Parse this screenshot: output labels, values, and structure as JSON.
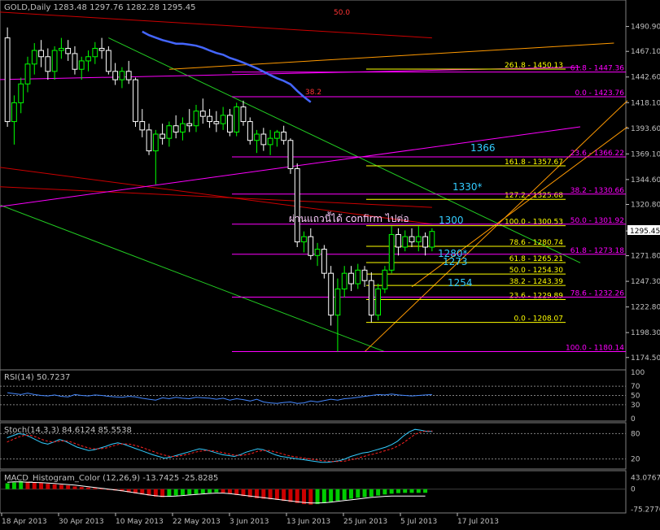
{
  "header": {
    "main": "GOLD,Daily  1283.48 1297.76 1282.28 1295.45",
    "rsi": "RSI(14) 50.7237",
    "stoch": "Stoch(14,3,3) 84.6124 85.5538",
    "macd": "MACD_Histogram_Color (12,26,9) -13.7425 -25.8285"
  },
  "colors": {
    "background": "#000000",
    "axis": "#c0c0c0",
    "candle_up": "#00ff00",
    "fib_lines": "#ffff00",
    "fib_ext": "#ff00ff",
    "trend_green": "#22cc22",
    "trend_red": "#cc0000",
    "trend_orange": "#ff9900",
    "ma_blue": "#4466ff",
    "annot_cyan": "#33ccff",
    "bands_mag": "#cc00cc"
  },
  "price_label": "1295.45",
  "annotation_text": "ผ่านแถวนี้ได้ confirm ไปต่อ",
  "targets": [
    "1366",
    "1330*",
    "1300",
    "1280*",
    "1273",
    "1254"
  ],
  "chart_data": [
    {
      "type": "candlestick",
      "title": "GOLD,Daily",
      "ylim": [
        1165,
        1510
      ],
      "y_ticks": [
        "1490.90",
        "1467.10",
        "1442.60",
        "1418.10",
        "1393.60",
        "1369.10",
        "1344.60",
        "1320.80",
        "1295.45",
        "1271.80",
        "1247.30",
        "1222.80",
        "1198.30",
        "1174.50"
      ],
      "x_ticks": [
        "18 Apr 2013",
        "30 Apr 2013",
        "10 May 2013",
        "22 May 2013",
        "3 Jun 2013",
        "13 Jun 2013",
        "25 Jun 2013",
        "5 Jul 2013",
        "17 Jul 2013"
      ],
      "candles_ohlc": [
        [
          1480,
          1490,
          1395,
          1400
        ],
        [
          1400,
          1425,
          1378,
          1418
        ],
        [
          1418,
          1442,
          1408,
          1436
        ],
        [
          1436,
          1462,
          1428,
          1455
        ],
        [
          1455,
          1475,
          1445,
          1468
        ],
        [
          1468,
          1478,
          1452,
          1462
        ],
        [
          1462,
          1470,
          1440,
          1448
        ],
        [
          1448,
          1472,
          1440,
          1468
        ],
        [
          1468,
          1480,
          1460,
          1470
        ],
        [
          1470,
          1478,
          1458,
          1465
        ],
        [
          1465,
          1472,
          1445,
          1450
        ],
        [
          1450,
          1462,
          1440,
          1458
        ],
        [
          1458,
          1468,
          1448,
          1462
        ],
        [
          1462,
          1476,
          1455,
          1470
        ],
        [
          1470,
          1480,
          1460,
          1468
        ],
        [
          1468,
          1472,
          1445,
          1448
        ],
        [
          1448,
          1456,
          1435,
          1440
        ],
        [
          1440,
          1452,
          1432,
          1448
        ],
        [
          1448,
          1458,
          1436,
          1440
        ],
        [
          1440,
          1442,
          1395,
          1400
        ],
        [
          1400,
          1412,
          1385,
          1392
        ],
        [
          1392,
          1398,
          1368,
          1372
        ],
        [
          1372,
          1392,
          1340,
          1388
        ],
        [
          1388,
          1398,
          1378,
          1384
        ],
        [
          1384,
          1400,
          1376,
          1396
        ],
        [
          1396,
          1406,
          1384,
          1390
        ],
        [
          1390,
          1404,
          1382,
          1398
        ],
        [
          1398,
          1412,
          1390,
          1396
        ],
        [
          1396,
          1416,
          1390,
          1410
        ],
        [
          1410,
          1422,
          1398,
          1405
        ],
        [
          1405,
          1412,
          1394,
          1400
        ],
        [
          1400,
          1410,
          1390,
          1398
        ],
        [
          1398,
          1414,
          1392,
          1406
        ],
        [
          1406,
          1412,
          1386,
          1390
        ],
        [
          1390,
          1418,
          1386,
          1414
        ],
        [
          1414,
          1420,
          1396,
          1400
        ],
        [
          1400,
          1404,
          1378,
          1382
        ],
        [
          1382,
          1392,
          1370,
          1388
        ],
        [
          1388,
          1394,
          1372,
          1378
        ],
        [
          1378,
          1392,
          1368,
          1384
        ],
        [
          1384,
          1392,
          1376,
          1390
        ],
        [
          1390,
          1396,
          1378,
          1382
        ],
        [
          1382,
          1384,
          1350,
          1355
        ],
        [
          1355,
          1360,
          1280,
          1285
        ],
        [
          1285,
          1295,
          1275,
          1290
        ],
        [
          1290,
          1298,
          1268,
          1272
        ],
        [
          1272,
          1284,
          1262,
          1278
        ],
        [
          1278,
          1282,
          1250,
          1255
        ],
        [
          1255,
          1262,
          1205,
          1215
        ],
        [
          1215,
          1250,
          1180,
          1240
        ],
        [
          1240,
          1262,
          1232,
          1255
        ],
        [
          1255,
          1262,
          1238,
          1245
        ],
        [
          1245,
          1264,
          1240,
          1258
        ],
        [
          1258,
          1262,
          1242,
          1248
        ],
        [
          1248,
          1256,
          1208,
          1215
        ],
        [
          1215,
          1245,
          1210,
          1240
        ],
        [
          1240,
          1262,
          1236,
          1258
        ],
        [
          1258,
          1300,
          1255,
          1292
        ],
        [
          1292,
          1298,
          1272,
          1280
        ],
        [
          1280,
          1296,
          1276,
          1290
        ],
        [
          1290,
          1298,
          1280,
          1285
        ],
        [
          1285,
          1300,
          1276,
          1290
        ],
        [
          1290,
          1294,
          1272,
          1280
        ],
        [
          1280,
          1298,
          1276,
          1295
        ]
      ],
      "fib_levels": [
        {
          "label": "261.8 - 1450.13",
          "value": 1450.13
        },
        {
          "label": "161.8 - 1357.67",
          "value": 1357.67
        },
        {
          "label": "127.2 - 1325.68",
          "value": 1325.68
        },
        {
          "label": "100.0 - 1300.53",
          "value": 1300.53
        },
        {
          "label": "78.6 - 1280.74",
          "value": 1280.74
        },
        {
          "label": "61.8 - 1265.21",
          "value": 1265.21
        },
        {
          "label": "50.0 - 1254.30",
          "value": 1254.3
        },
        {
          "label": "38.2 - 1243.39",
          "value": 1243.39
        },
        {
          "label": "23.6 - 1229.89",
          "value": 1229.89
        },
        {
          "label": "0.0 - 1208.07",
          "value": 1208.07
        }
      ],
      "fib_ext_levels": [
        {
          "label": "61.8 - 1447.36",
          "value": 1447.36
        },
        {
          "label": "0.0 - 1423.76",
          "value": 1423.76
        },
        {
          "label": "23.6 - 1366.22",
          "value": 1366.22
        },
        {
          "label": "38.2 - 1330.66",
          "value": 1330.66
        },
        {
          "label": "50.0 - 1301.92",
          "value": 1301.92
        },
        {
          "label": "61.8 - 1273.18",
          "value": 1273.18
        },
        {
          "label": "78.6 - 1232.26",
          "value": 1232.26
        },
        {
          "label": "100.0 - 1180.14",
          "value": 1180.14
        }
      ],
      "top_labels": [
        "50.0",
        "38.2"
      ]
    },
    {
      "type": "line",
      "title": "RSI(14) 50.7237",
      "ylim": [
        0,
        100
      ],
      "y_ticks": [
        "100",
        "70",
        "50",
        "30",
        "0"
      ],
      "values": [
        56,
        54,
        52,
        55,
        52,
        50,
        49,
        51,
        48,
        47,
        52,
        50,
        49,
        51,
        50,
        48,
        47,
        46,
        48,
        47,
        44,
        42,
        40,
        45,
        43,
        46,
        44,
        43,
        46,
        45,
        44,
        42,
        44,
        40,
        43,
        41,
        38,
        42,
        36,
        34,
        33,
        35,
        36,
        33,
        34,
        38,
        36,
        39,
        42,
        40,
        43,
        44,
        46,
        48,
        50,
        52,
        51,
        53,
        51,
        50,
        49,
        50,
        51,
        52
      ]
    },
    {
      "type": "line",
      "title": "Stoch(14,3,3) 84.6124 85.5538",
      "ylim": [
        0,
        100
      ],
      "y_ticks": [
        "80",
        "20"
      ],
      "series": [
        {
          "name": "main",
          "values": [
            70,
            75,
            80,
            78,
            72,
            65,
            58,
            55,
            60,
            66,
            62,
            55,
            48,
            44,
            40,
            42,
            46,
            50,
            55,
            58,
            55,
            50,
            45,
            40,
            35,
            30,
            26,
            22,
            24,
            28,
            32,
            36,
            40,
            44,
            42,
            38,
            34,
            30,
            28,
            26,
            30,
            36,
            40,
            44,
            42,
            36,
            30,
            26,
            24,
            22,
            20,
            18,
            16,
            14,
            12,
            12,
            14,
            16,
            20,
            26,
            30,
            34,
            36,
            40,
            44,
            48,
            54,
            62,
            74,
            84,
            90,
            88,
            85,
            85
          ]
        },
        {
          "name": "signal",
          "values": [
            60,
            66,
            72,
            76,
            76,
            72,
            66,
            62,
            60,
            62,
            63,
            60,
            55,
            50,
            46,
            44,
            44,
            46,
            50,
            54,
            56,
            55,
            52,
            48,
            43,
            38,
            33,
            29,
            26,
            26,
            28,
            31,
            35,
            38,
            40,
            40,
            38,
            35,
            32,
            29,
            28,
            30,
            33,
            38,
            40,
            40,
            37,
            33,
            29,
            26,
            24,
            22,
            20,
            18,
            16,
            15,
            14,
            14,
            15,
            18,
            21,
            25,
            29,
            32,
            36,
            40,
            44,
            50,
            58,
            68,
            78,
            84,
            86,
            86
          ]
        }
      ]
    },
    {
      "type": "bar",
      "title": "MACD_Histogram_Color (12,26,9) -13.7425 -25.8285",
      "ylim": [
        -80,
        60
      ],
      "y_ticks": [
        "43.0767",
        "0",
        "-75.2776"
      ],
      "values": [
        22,
        25,
        30,
        28,
        26,
        24,
        20,
        18,
        16,
        14,
        10,
        8,
        6,
        4,
        2,
        -2,
        -5,
        -8,
        -12,
        -16,
        -20,
        -24,
        -28,
        -30,
        -28,
        -24,
        -22,
        -20,
        -18,
        -16,
        -14,
        -12,
        -14,
        -18,
        -22,
        -26,
        -30,
        -34,
        -36,
        -38,
        -40,
        -44,
        -48,
        -52,
        -56,
        -58,
        -56,
        -52,
        -48,
        -44,
        -40,
        -36,
        -32,
        -30,
        -28,
        -24,
        -20,
        -17,
        -15,
        -14,
        -14,
        -14,
        -13.7425
      ],
      "signal": [
        26,
        27,
        27,
        26,
        25,
        24,
        23,
        21,
        19,
        17,
        15,
        12,
        9,
        6,
        3,
        0,
        -3,
        -6,
        -10,
        -14,
        -18,
        -22,
        -25,
        -27,
        -27,
        -26,
        -24,
        -22,
        -20,
        -18,
        -16,
        -15,
        -15,
        -17,
        -20,
        -23,
        -26,
        -29,
        -32,
        -35,
        -38,
        -41,
        -44,
        -47,
        -50,
        -52,
        -52,
        -51,
        -49,
        -46,
        -43,
        -40,
        -37,
        -34,
        -31,
        -29,
        -27,
        -26,
        -26,
        -26,
        -26,
        -26,
        -25.8285
      ]
    }
  ]
}
